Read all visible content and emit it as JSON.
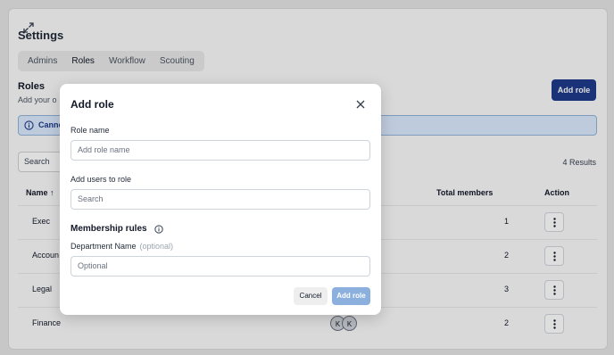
{
  "page": {
    "title": "Settings",
    "tabs": [
      {
        "label": "Admins"
      },
      {
        "label": "Roles"
      },
      {
        "label": "Workflow"
      },
      {
        "label": "Scouting"
      }
    ],
    "active_tab": "Roles",
    "section_title": "Roles",
    "section_sub": "Add your o",
    "add_role_button": "Add role",
    "alert_text": "Canno",
    "search_placeholder": "Search",
    "results": "4 Results"
  },
  "table": {
    "headers": {
      "name": "Name",
      "total_members": "Total members",
      "action": "Action"
    },
    "rows": [
      {
        "name": "Exec",
        "count": "1"
      },
      {
        "name": "Accoun",
        "count": "2"
      },
      {
        "name": "Legal",
        "count": "3"
      },
      {
        "name": "Finance",
        "count": "2",
        "avatars": [
          "K",
          "K"
        ]
      }
    ]
  },
  "modal": {
    "title": "Add role",
    "role_name_label": "Role name",
    "role_name_placeholder": "Add role name",
    "users_label": "Add users to role",
    "users_placeholder": "Search",
    "membership_title": "Membership rules",
    "department_label": "Department Name",
    "department_optional": "(optional)",
    "department_placeholder": "Optional",
    "cancel": "Cancel",
    "add": "Add role"
  },
  "colors": {
    "accent": "#1e3a8a",
    "disabled_button": "#8bb0dd",
    "alert_bg": "#dbeafe"
  }
}
